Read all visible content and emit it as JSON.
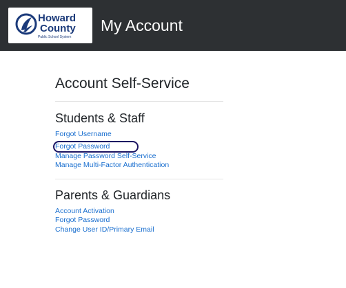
{
  "header": {
    "logo": {
      "word1": "Howard",
      "word2": "County",
      "tagline": "Public School System",
      "icon": "flame-leaf-icon",
      "brand_color": "#1b3a7a"
    },
    "title": "My Account",
    "bg_color": "#2d3033"
  },
  "main": {
    "heading": "Account Self-Service",
    "sections": [
      {
        "title": "Students & Staff",
        "links": [
          "Forgot Username",
          "Forgot Password",
          "Manage Password Self-Service",
          "Manage Multi-Factor Authentication"
        ],
        "highlighted_link": "Forgot Password"
      },
      {
        "title": "Parents & Guardians",
        "links": [
          "Account Activation",
          "Forgot Password",
          "Change User ID/Primary Email"
        ]
      }
    ]
  },
  "colors": {
    "link": "#1a6fcf",
    "highlight_ring": "#1b1462",
    "heading_text": "#212529",
    "divider": "#e3e3e3"
  }
}
